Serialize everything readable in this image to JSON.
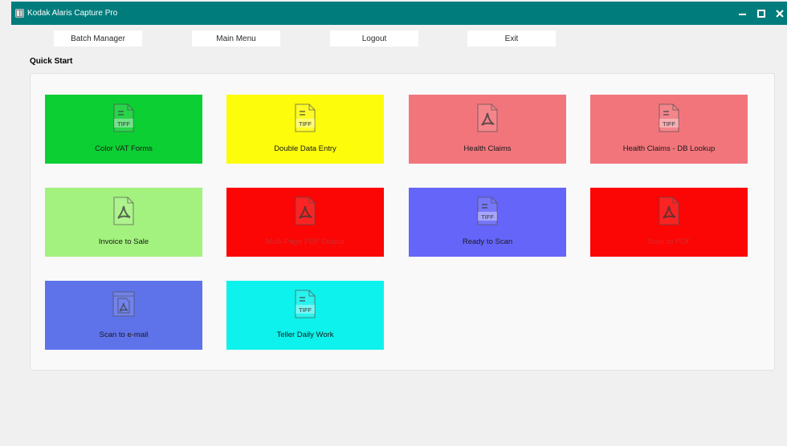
{
  "window": {
    "title": "Kodak Alaris Capture Pro",
    "icon": "app-book-icon",
    "controls": [
      "minimize-icon",
      "maximize-icon",
      "close-icon"
    ],
    "titlebar_color": "#007c7c"
  },
  "toolbar": {
    "buttons": [
      {
        "label": "Batch Manager"
      },
      {
        "label": "Main Menu"
      },
      {
        "label": "Logout"
      },
      {
        "label": "Exit"
      }
    ]
  },
  "quick_start": {
    "title": "Quick Start",
    "tiles": [
      {
        "label": "Color VAT Forms",
        "icon": "tiff-file-icon",
        "color": "#0ccf33",
        "text_color": "#1a1a1a"
      },
      {
        "label": "Double Data Entry",
        "icon": "tiff-file-icon",
        "color": "#fdfc0a",
        "text_color": "#1a1a1a"
      },
      {
        "label": "Health Claims",
        "icon": "pdf-file-icon",
        "color": "#f2757b",
        "text_color": "#1a1a1a"
      },
      {
        "label": "Health Claims - DB Lookup",
        "icon": "tiff-file-icon",
        "color": "#f2757b",
        "text_color": "#1a1a1a"
      },
      {
        "label": "Invoice to Sale",
        "icon": "pdf-file-icon",
        "color": "#a3f27f",
        "text_color": "#1a1a1a"
      },
      {
        "label": "Multi-Page PDF Output",
        "icon": "pdf-file-icon",
        "color": "#fb0505",
        "text_color": "#d12e2e"
      },
      {
        "label": "Ready to Scan",
        "icon": "tiff-file-icon",
        "color": "#6565fa",
        "text_color": "#1a1a1a"
      },
      {
        "label": "Scan to PDF",
        "icon": "pdf-file-icon",
        "color": "#fb0505",
        "text_color": "#d12e2e"
      },
      {
        "label": "Scan to e-mail",
        "icon": "email-pdf-icon",
        "color": "#5e72ea",
        "text_color": "#1a1a1a"
      },
      {
        "label": "Teller Daily Work",
        "icon": "tiff-file-icon",
        "color": "#0df2ec",
        "text_color": "#1a1a1a"
      }
    ]
  }
}
